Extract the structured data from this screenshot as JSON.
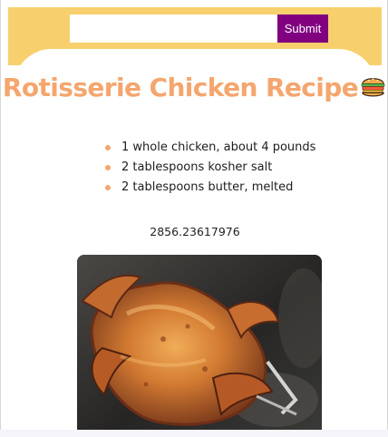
{
  "search": {
    "placeholder": "",
    "value": ""
  },
  "submit_label": "Submit",
  "title": "Rotisserie Chicken Recipe",
  "ingredients": [
    "1 whole chicken, about 4 pounds",
    "2 tablespoons kosher salt",
    "2 tablespoons butter, melted"
  ],
  "number_text": "2856.23617976",
  "icons": {
    "title_icon": "hamburger-icon",
    "bullet": "orange-dot"
  },
  "colors": {
    "header": "#f7d06d",
    "button": "#800080",
    "title": "#f4a66e",
    "bullet": "#f4a66e"
  }
}
